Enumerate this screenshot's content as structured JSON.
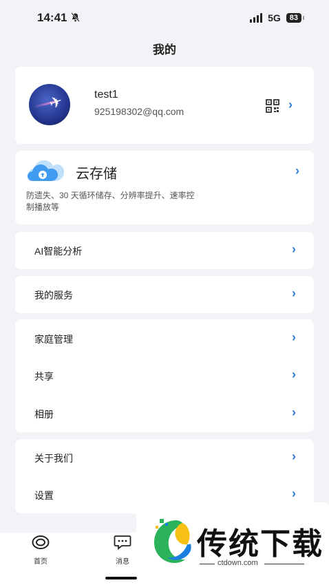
{
  "status_bar": {
    "time": "14:41",
    "network": "5G",
    "battery": "83"
  },
  "page": {
    "title": "我的"
  },
  "profile": {
    "name": "test1",
    "email": "925198302@qq.com"
  },
  "cloud": {
    "title": "云存储",
    "description": "防遗失、30 天循环储存、分辨率提升、速率控制播放等"
  },
  "menu": {
    "ai": "AI智能分析",
    "services": "我的服务",
    "family": "家庭管理",
    "share": "共享",
    "album": "相册",
    "about": "关于我们",
    "settings": "设置"
  },
  "tabs": [
    {
      "label": "首页",
      "icon": "home-icon"
    },
    {
      "label": "消息",
      "icon": "message-icon"
    }
  ],
  "watermark": {
    "text": "传统下载",
    "url": "ctdown.com"
  },
  "colors": {
    "accent": "#2a7bd6",
    "background": "#f2f3f7"
  }
}
